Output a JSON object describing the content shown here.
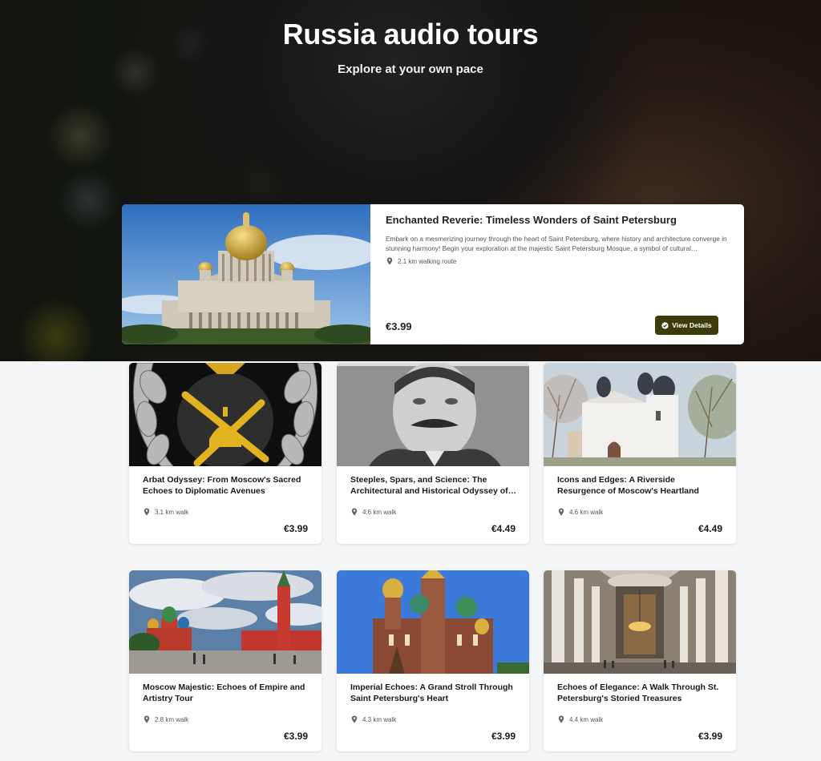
{
  "hero": {
    "title": "Russia audio tours",
    "subtitle": "Explore at your own pace"
  },
  "featured": {
    "title": "Enchanted Reverie: Timeless Wonders of Saint Petersburg",
    "description": "Embark on a mesmerizing journey through the heart of Saint Petersburg, where history and architecture converge in stunning harmony! Begin your exploration at the majestic Saint Petersburg Mosque, a symbol of cultural…",
    "distance": "2.1 km walking route",
    "price": "€3.99",
    "button_label": "View Details",
    "pin_icon": "location-pin-icon",
    "button_icon": "check-circle-icon",
    "button_color": "#3c3c0a"
  },
  "tours": [
    {
      "title": "Arbat Odyssey: From Moscow's Sacred Echoes to Diplomatic Avenues",
      "distance": "3.1 km walk",
      "price": "€3.99"
    },
    {
      "title": "Steeples, Spars, and Science: The Architectural and Historical Odyssey of…",
      "distance": "4.6 km walk",
      "price": "€4.49"
    },
    {
      "title": "Icons and Edges: A Riverside Resurgence of Moscow's Heartland",
      "distance": "4.6 km walk",
      "price": "€4.49"
    },
    {
      "title": "Moscow Majestic: Echoes of Empire and Artistry Tour",
      "distance": "2.8 km walk",
      "price": "€3.99"
    },
    {
      "title": "Imperial Echoes: A Grand Stroll Through Saint Petersburg's Heart",
      "distance": "4.3 km walk",
      "price": "€3.99"
    },
    {
      "title": "Echoes of Elegance: A Walk Through St. Petersburg's Storied Treasures",
      "distance": "4.4 km walk",
      "price": "€3.99"
    }
  ]
}
